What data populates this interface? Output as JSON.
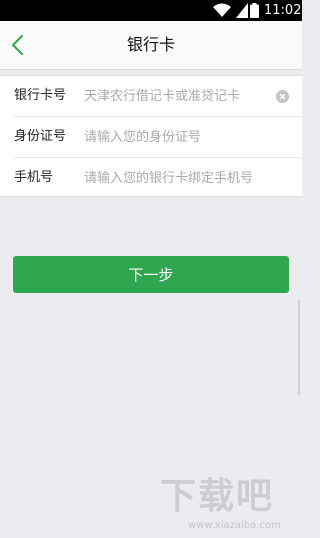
{
  "status_bar": {
    "time": "11:02",
    "icons": [
      "wifi-icon",
      "signal-icon",
      "battery-icon"
    ]
  },
  "nav": {
    "title": "银行卡",
    "back_icon": "chevron-left-icon"
  },
  "form": {
    "rows": [
      {
        "label": "银行卡号",
        "placeholder": "天津农行借记卡或准贷记卡",
        "has_clear": true
      },
      {
        "label": "身份证号",
        "placeholder": "请输入您的身份证号"
      },
      {
        "label": "手机号",
        "placeholder": "请输入您的银行卡绑定手机号"
      }
    ]
  },
  "next_button": {
    "label": "下一步"
  },
  "watermark": {
    "text": "下载吧",
    "url": "www.xiazaiba.com"
  },
  "colors": {
    "accent": "#2fa751",
    "background": "#ebebf0",
    "status_bar": "#000000"
  }
}
